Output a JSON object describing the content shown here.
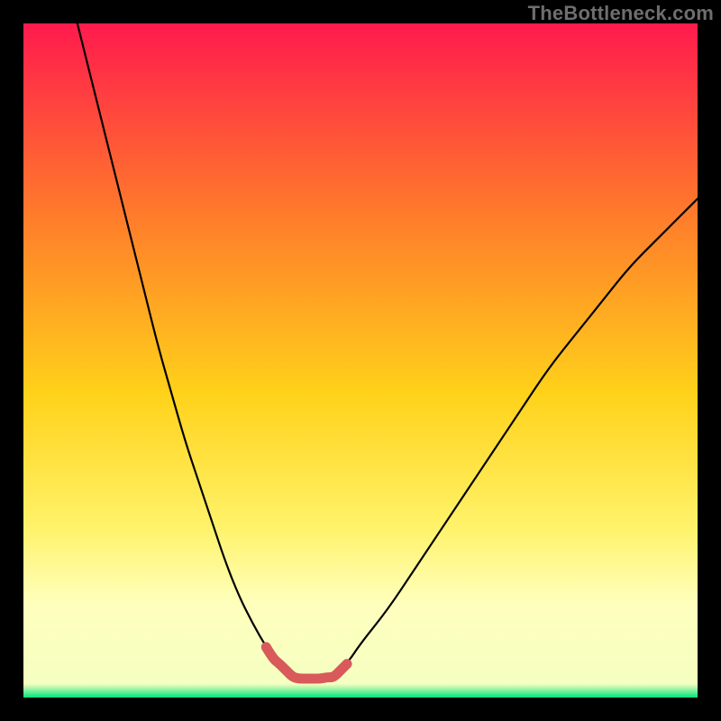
{
  "watermark": "TheBottleneck.com",
  "colors": {
    "frame": "#000000",
    "gradient_top": "#ff1a4d",
    "gradient_mid1": "#ff7a2b",
    "gradient_mid2": "#ffd21a",
    "gradient_mid3": "#fff36b",
    "gradient_low_band": "#ffffbd",
    "gradient_bottom": "#00e57a",
    "curve": "#000000",
    "highlight": "#d85a5a"
  },
  "chart_data": {
    "type": "line",
    "title": "",
    "xlabel": "",
    "ylabel": "",
    "xlim": [
      0,
      100
    ],
    "ylim": [
      0,
      100
    ],
    "grid": false,
    "legend": false,
    "annotations": [],
    "series": [
      {
        "name": "bottleneck_curve_left",
        "x": [
          8,
          10,
          12,
          14,
          16,
          18,
          20,
          22,
          24,
          26,
          28,
          30,
          32,
          34,
          36,
          38,
          40
        ],
        "values": [
          100,
          92,
          84,
          76,
          68,
          60,
          52,
          45,
          38,
          32,
          26,
          20,
          15,
          11,
          7.5,
          5,
          3
        ]
      },
      {
        "name": "bottleneck_curve_right",
        "x": [
          46,
          48,
          50,
          54,
          58,
          62,
          66,
          70,
          74,
          78,
          82,
          86,
          90,
          94,
          98,
          100
        ],
        "values": [
          3,
          5,
          8,
          13,
          19,
          25,
          31,
          37,
          43,
          49,
          54,
          59,
          64,
          68,
          72,
          74
        ]
      },
      {
        "name": "optimal_band_highlight",
        "x": [
          36,
          37,
          38,
          39,
          40,
          41,
          42,
          43,
          44,
          45,
          46,
          47,
          48
        ],
        "values": [
          7.5,
          5.8,
          5,
          4,
          3,
          2.8,
          2.8,
          2.8,
          2.8,
          3,
          3,
          4,
          5
        ]
      }
    ]
  }
}
